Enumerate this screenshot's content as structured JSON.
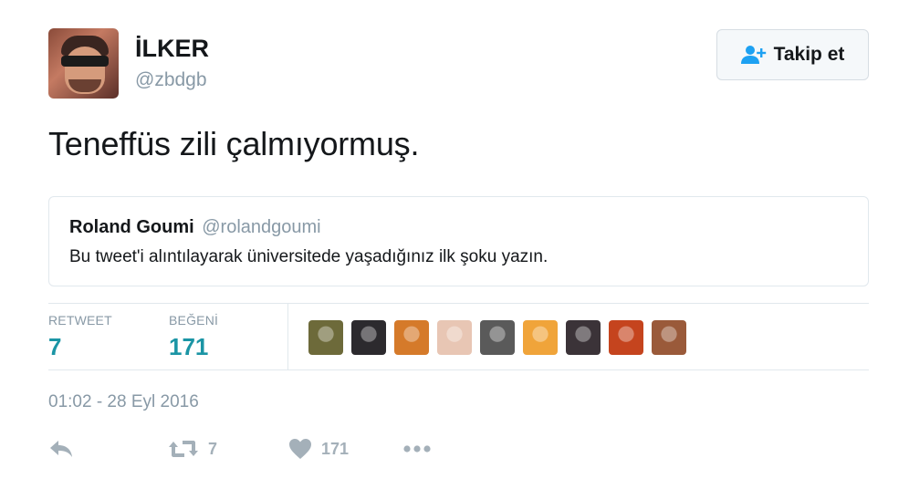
{
  "author": {
    "name": "İLKER",
    "handle": "@zbdgb"
  },
  "follow_button": {
    "label": "Takip et",
    "icon": "add-user-icon"
  },
  "tweet": {
    "text": "Teneffüs zili çalmıyormuş."
  },
  "quoted_tweet": {
    "name": "Roland Goumi",
    "handle": "@rolandgoumi",
    "text": "Bu tweet'i alıntılayarak üniversitede yaşadığınız ilk şoku yazın."
  },
  "stats": {
    "retweets_label": "RETWEET",
    "retweets_value": "7",
    "likes_label": "BEĞENİ",
    "likes_value": "171",
    "liker_avatars": [
      {
        "icon": "liker-avatar-1",
        "color": "#6d6a3a"
      },
      {
        "icon": "liker-avatar-2",
        "color": "#2c2a2e"
      },
      {
        "icon": "liker-avatar-3",
        "color": "#d57a2a"
      },
      {
        "icon": "liker-avatar-4",
        "color": "#e8c6b4"
      },
      {
        "icon": "liker-avatar-5",
        "color": "#5a5a5a"
      },
      {
        "icon": "liker-avatar-6",
        "color": "#f0a43a"
      },
      {
        "icon": "liker-avatar-7",
        "color": "#3b3338"
      },
      {
        "icon": "liker-avatar-8",
        "color": "#c5441e"
      },
      {
        "icon": "liker-avatar-9",
        "color": "#9a5a3a"
      }
    ]
  },
  "timestamp": "01:02 - 28 Eyl 2016",
  "actions": {
    "reply_icon": "reply-icon",
    "retweet_icon": "retweet-icon",
    "retweet_count": "7",
    "like_icon": "heart-icon",
    "like_count": "171",
    "more_icon": "more-icon"
  },
  "colors": {
    "stat_value": "#1b95a5",
    "muted": "#8899a6",
    "action": "#a4b0b9",
    "follow_icon": "#1da1f2"
  }
}
